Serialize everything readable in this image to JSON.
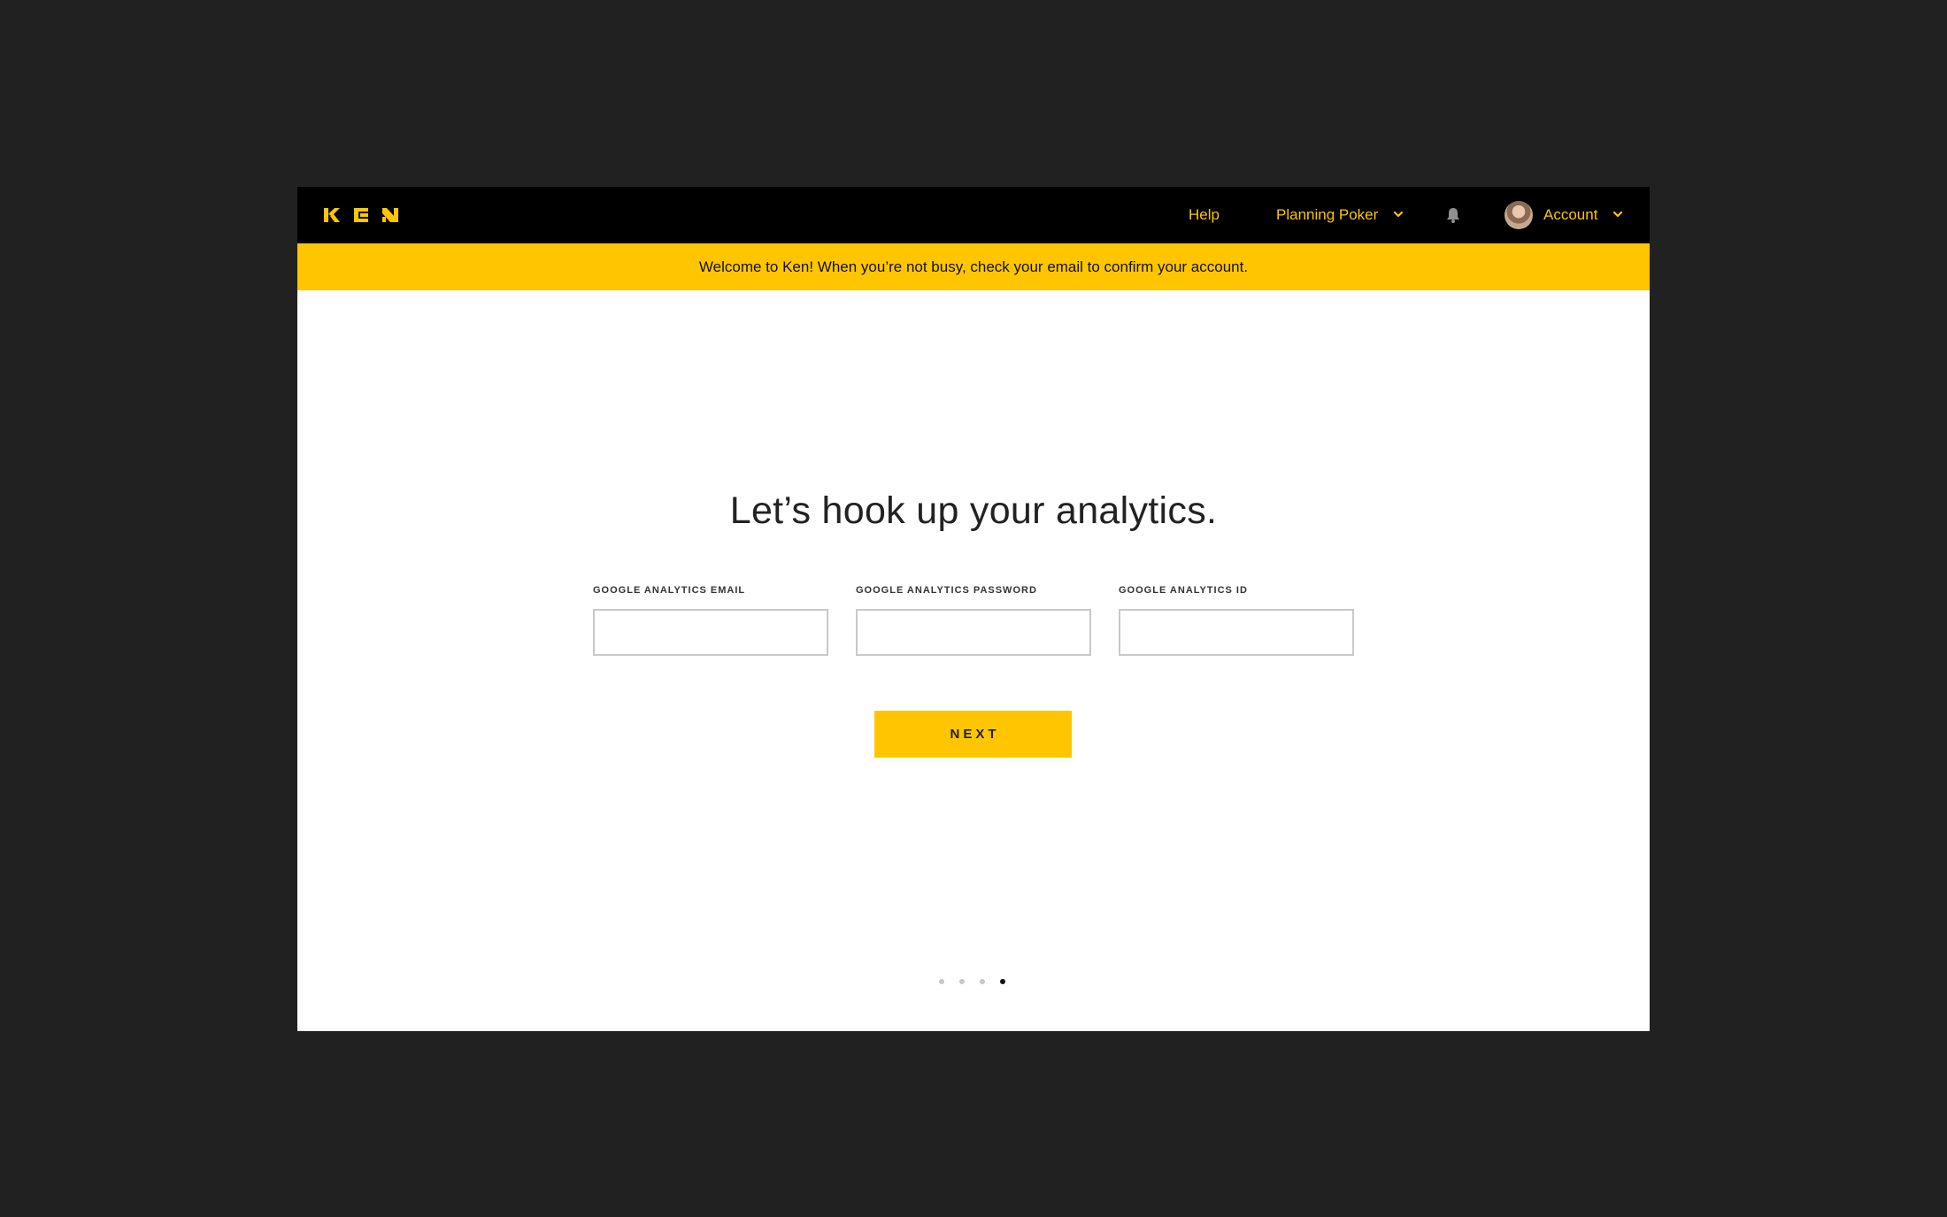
{
  "app": {
    "brand": "KEN",
    "accent_color": "#ffc600",
    "background_color": "#212121"
  },
  "nav": {
    "help_label": "Help",
    "planning_label": "Planning Poker",
    "notifications_icon": "bell-icon",
    "account_label": "Account"
  },
  "banner": {
    "text": "Welcome to Ken! When you’re not busy, check your email to confirm your account."
  },
  "main": {
    "headline": "Let’s hook up your analytics.",
    "fields": [
      {
        "label": "GOOGLE ANALYTICS EMAIL",
        "value": "",
        "placeholder": ""
      },
      {
        "label": "GOOGLE ANALYTICS PASSWORD",
        "value": "",
        "placeholder": ""
      },
      {
        "label": "GOOGLE ANALYTICS ID",
        "value": "",
        "placeholder": ""
      }
    ],
    "next_label": "NEXT"
  },
  "pager": {
    "total_steps": 4,
    "current_step": 4
  }
}
